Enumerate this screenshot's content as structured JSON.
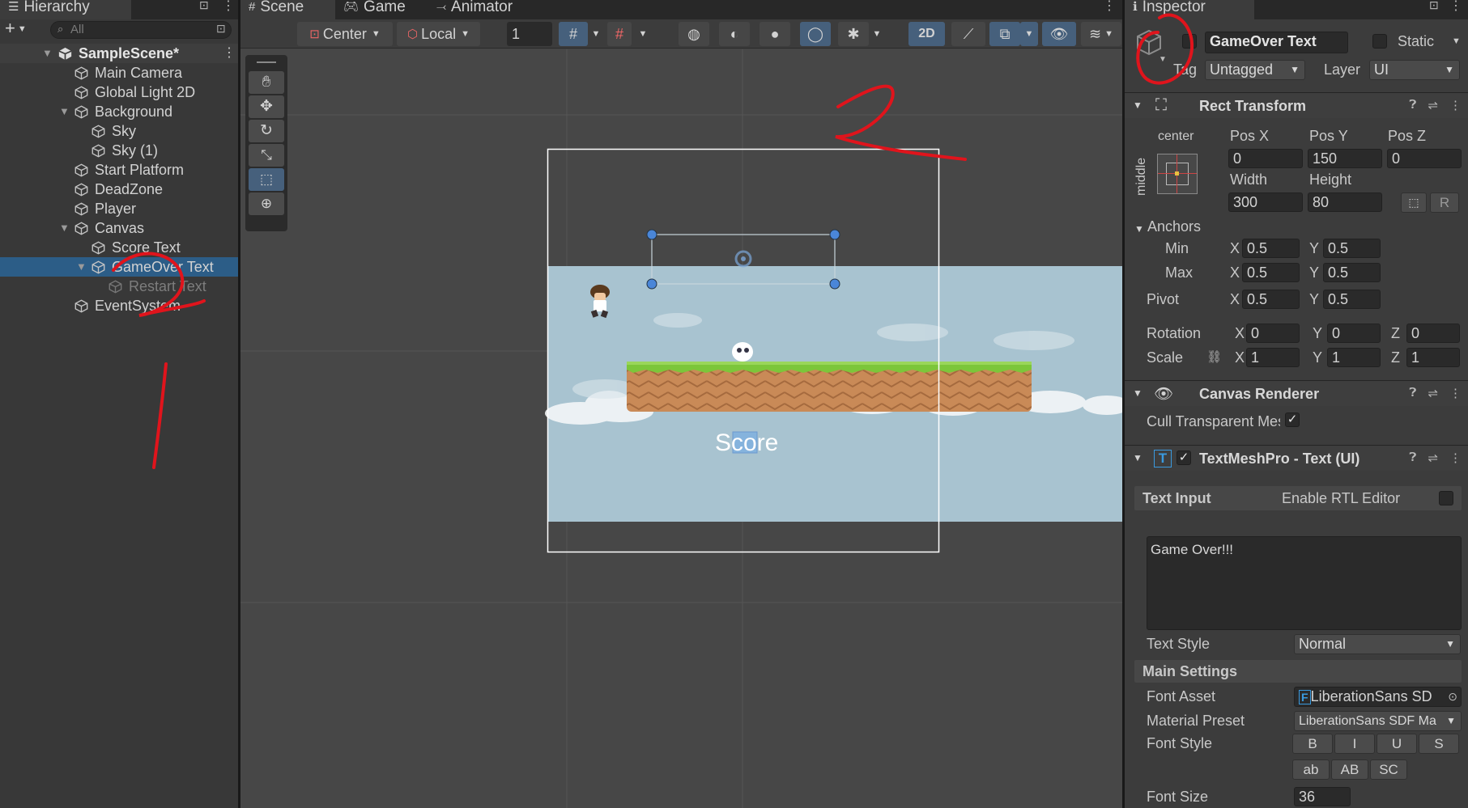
{
  "hierarchy": {
    "tab_label": "Hierarchy",
    "search_placeholder": "All",
    "scene_name": "SampleScene*",
    "items": [
      {
        "label": "Main Camera"
      },
      {
        "label": "Global Light 2D"
      },
      {
        "label": "Background"
      },
      {
        "label": "Sky"
      },
      {
        "label": "Sky (1)"
      },
      {
        "label": "Start Platform"
      },
      {
        "label": "DeadZone"
      },
      {
        "label": "Player"
      },
      {
        "label": "Canvas"
      },
      {
        "label": "Score Text"
      },
      {
        "label": "GameOver Text"
      },
      {
        "label": "Restart Text"
      },
      {
        "label": "EventSystem"
      }
    ]
  },
  "scene": {
    "tabs": [
      {
        "label": "Scene"
      },
      {
        "label": "Game"
      },
      {
        "label": "Animator"
      }
    ],
    "toolbar": {
      "pivot_mode": "Center",
      "pivot_rotation": "Local",
      "grid_increment": "1",
      "mode_2d": "2D"
    },
    "score_text": "Score"
  },
  "inspector": {
    "tab_label": "Inspector",
    "object_name": "GameOver Text",
    "static_label": "Static",
    "tag_label": "Tag",
    "tag_value": "Untagged",
    "layer_label": "Layer",
    "layer_value": "UI",
    "rect_transform": {
      "title": "Rect Transform",
      "anchor_h": "center",
      "anchor_v": "middle",
      "pos_x_label": "Pos X",
      "pos_x": "0",
      "pos_y_label": "Pos Y",
      "pos_y": "150",
      "pos_z_label": "Pos Z",
      "pos_z": "0",
      "width_label": "Width",
      "width": "300",
      "height_label": "Height",
      "height": "80",
      "r_label": "R",
      "anchors_label": "Anchors",
      "min_label": "Min",
      "min_x": "0.5",
      "min_y": "0.5",
      "max_label": "Max",
      "max_x": "0.5",
      "max_y": "0.5",
      "pivot_label": "Pivot",
      "pivot_x": "0.5",
      "pivot_y": "0.5",
      "rotation_label": "Rotation",
      "rot_x": "0",
      "rot_y": "0",
      "rot_z": "0",
      "scale_label": "Scale",
      "scale_x": "1",
      "scale_y": "1",
      "scale_z": "1",
      "x": "X",
      "y": "Y",
      "z": "Z"
    },
    "canvas_renderer": {
      "title": "Canvas Renderer",
      "cull_label": "Cull Transparent Mes"
    },
    "tmp": {
      "title": "TextMeshPro - Text (UI)",
      "text_input_label": "Text Input",
      "rtl_label": "Enable RTL Editor",
      "text_value": "Game Over!!!",
      "text_style_label": "Text Style",
      "text_style_value": "Normal",
      "main_settings_label": "Main Settings",
      "font_asset_label": "Font Asset",
      "font_asset_value": "LiberationSans SD",
      "material_preset_label": "Material Preset",
      "material_preset_value": "LiberationSans SDF Ma",
      "font_style_label": "Font Style",
      "style_buttons": [
        "B",
        "I",
        "U",
        "S",
        "ab",
        "AB",
        "SC"
      ],
      "font_size_label": "Font Size",
      "font_size_value": "36"
    }
  },
  "colors": {
    "selection": "#2c5d87",
    "sky": "#a8c3d0",
    "grass": "#7cc63a",
    "dirt": "#c98a57",
    "annotation_red": "#e0141c"
  }
}
